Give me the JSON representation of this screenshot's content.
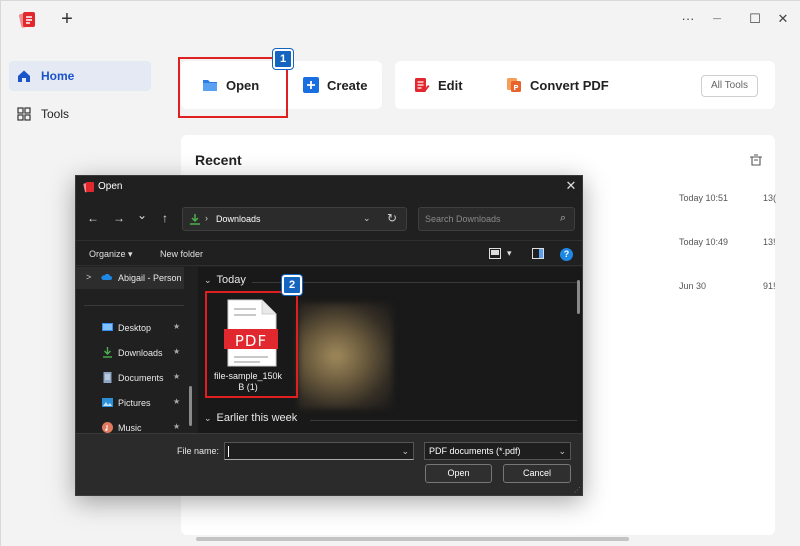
{
  "app": {
    "window_controls": {
      "more": "···",
      "minimize": "—",
      "maximize": "☐",
      "close": "✕"
    },
    "new_tab": "+",
    "sidebar": {
      "items": [
        {
          "label": "Home",
          "icon": "home-icon"
        },
        {
          "label": "Tools",
          "icon": "grid-icon"
        }
      ]
    },
    "actions": {
      "open": "Open",
      "create": "Create",
      "edit": "Edit",
      "convert": "Convert PDF",
      "all_tools": "All Tools"
    },
    "steps": {
      "one": "1",
      "two": "2"
    },
    "recent": {
      "title": "Recent",
      "rows": [
        {
          "time": "Today 10:51",
          "size": "13("
        },
        {
          "time": "Today 10:49",
          "size": "13!"
        },
        {
          "time": "Jun 30",
          "size": "91!"
        }
      ]
    },
    "colors": {
      "accent": "#1a54c8",
      "highlight": "#e02020",
      "badge": "#1565c0"
    }
  },
  "dialog": {
    "title": "Open",
    "close": "✕",
    "nav": {
      "back": "←",
      "forward": "→",
      "recent": "⌄",
      "up": "↑"
    },
    "address": {
      "chevron": "›",
      "path": "Downloads",
      "dropdown": "⌄",
      "refresh": "↻"
    },
    "search": {
      "placeholder": "Search Downloads",
      "icon": "⌕"
    },
    "command_bar": {
      "organize": "Organize ▾",
      "new_folder": "New folder",
      "view_dropdown": "▾",
      "help": "?"
    },
    "nav_pane": {
      "expander": ">",
      "items": [
        {
          "label": "Abigail - Person"
        },
        {
          "label": "Desktop",
          "pin": "★"
        },
        {
          "label": "Downloads",
          "pin": "★"
        },
        {
          "label": "Documents",
          "pin": "★"
        },
        {
          "label": "Pictures",
          "pin": "★"
        },
        {
          "label": "Music",
          "pin": "★"
        }
      ]
    },
    "groups": {
      "today": "Today",
      "earlier": "Earlier this week",
      "chevron": "⌄"
    },
    "file": {
      "badge": "PDF",
      "name_line1": "file-sample_150k",
      "name_line2": "B (1)"
    },
    "bottom": {
      "file_name_label": "File name:",
      "file_name_value": "",
      "file_name_dropdown": "⌄",
      "file_type": "PDF documents (*.pdf)",
      "file_type_dropdown": "⌄",
      "open_button": "Open",
      "cancel_button": "Cancel",
      "grip": "⋰"
    }
  }
}
